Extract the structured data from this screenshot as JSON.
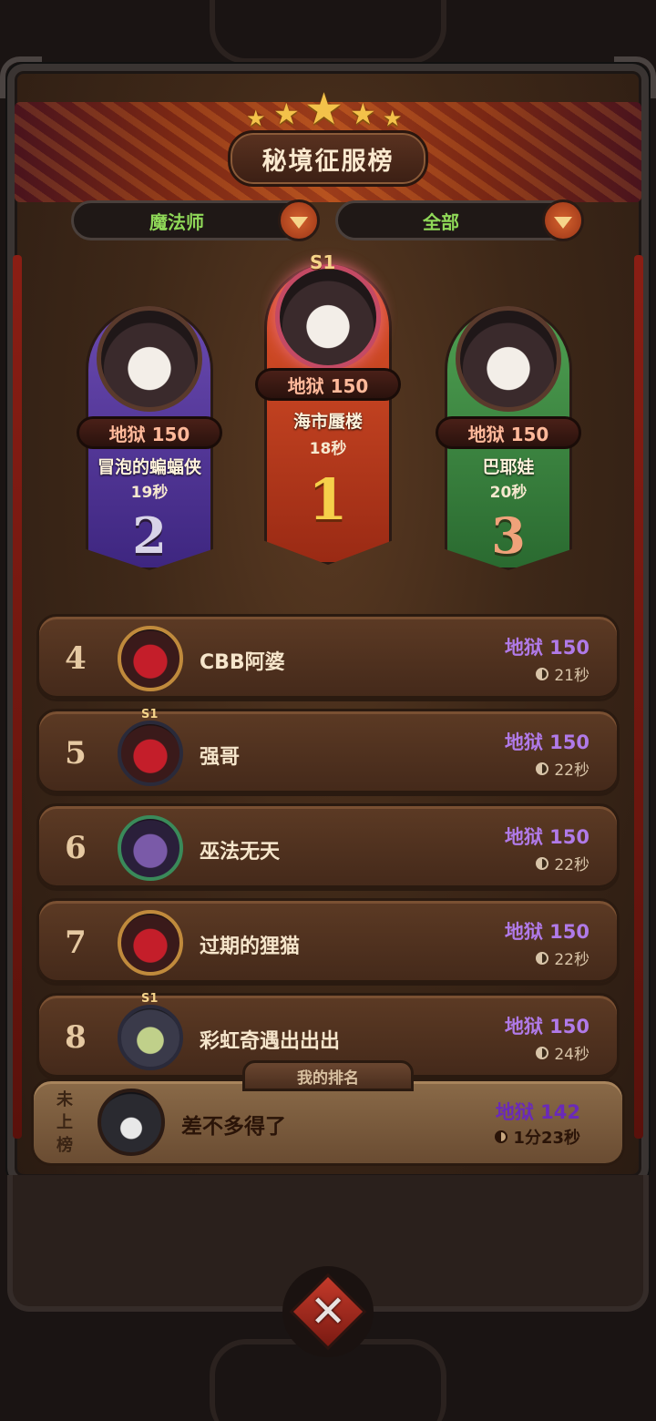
{
  "header": {
    "title": "秘境征服榜"
  },
  "filters": [
    {
      "label": "魔法师"
    },
    {
      "label": "全部"
    }
  ],
  "podium": {
    "first": {
      "rank": "1",
      "difficulty": "地狱 150",
      "name": "海市蜃楼",
      "time": "18秒",
      "badge": "S1"
    },
    "second": {
      "rank": "2",
      "difficulty": "地狱 150",
      "name": "冒泡的蝙蝠侠",
      "time": "19秒"
    },
    "third": {
      "rank": "3",
      "difficulty": "地狱 150",
      "name": "巴耶娃",
      "time": "20秒"
    }
  },
  "rows": [
    {
      "rank": "4",
      "name": "CBB阿婆",
      "difficulty": "地狱 150",
      "time": "21秒"
    },
    {
      "rank": "5",
      "name": "强哥",
      "difficulty": "地狱 150",
      "time": "22秒",
      "badge": "S1"
    },
    {
      "rank": "6",
      "name": "巫法无天",
      "difficulty": "地狱 150",
      "time": "22秒"
    },
    {
      "rank": "7",
      "name": "过期的狸猫",
      "difficulty": "地狱 150",
      "time": "22秒"
    },
    {
      "rank": "8",
      "name": "彩虹奇遇出出出",
      "difficulty": "地狱 150",
      "time": "24秒",
      "badge": "S1"
    }
  ],
  "my_rank": {
    "tab_label": "我的排名",
    "status": [
      "未",
      "上",
      "榜"
    ],
    "name": "差不多得了",
    "difficulty": "地狱 142",
    "time": "1分23秒"
  },
  "icons": {
    "close": "close-icon",
    "dropdown": "chevron-down-icon",
    "clock": "clock-icon",
    "star": "star-icon"
  },
  "colors": {
    "difficulty_text": "#b07ae8",
    "filter_text": "#8fd858",
    "gold": "#f6d04a"
  }
}
